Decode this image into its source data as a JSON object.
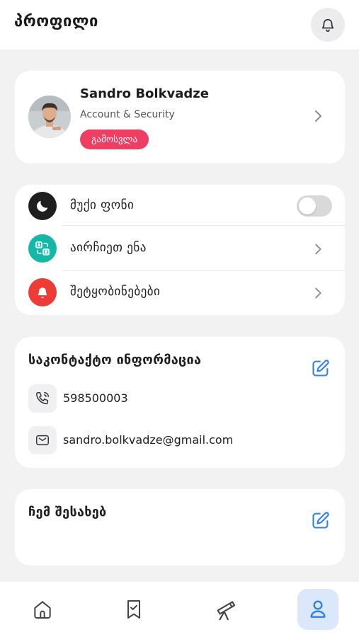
{
  "header": {
    "title": "პროფილი",
    "notification_icon": "bell-icon"
  },
  "profile": {
    "name": "Sandro Bolkvadze",
    "subtitle": "Account & Security",
    "logout_label": "გამოსვლა",
    "avatar_icon": "user-photo"
  },
  "settings": {
    "items": [
      {
        "label": "მუქი ფონი",
        "icon": "moon-icon",
        "icon_bg": "#1f1f1f",
        "control": "toggle",
        "toggle_on": false
      },
      {
        "label": "აირჩიეთ ენა",
        "icon": "translate-icon",
        "icon_bg": "#14b8a6",
        "control": "chevron"
      },
      {
        "label": "შეტყობინებები",
        "icon": "bell-icon",
        "icon_bg": "#ef3b36",
        "control": "chevron"
      }
    ]
  },
  "contact": {
    "title": "საკონტაქტო ინფორმაცია",
    "phone": "598500003",
    "email": "sandro.bolkvadze@gmail.com"
  },
  "about": {
    "title": "ჩემ შესახებ"
  },
  "bottom_nav": {
    "items": [
      {
        "icon": "home-icon",
        "active": false
      },
      {
        "icon": "bookmark-check-icon",
        "active": false
      },
      {
        "icon": "telescope-icon",
        "active": false
      },
      {
        "icon": "user-icon",
        "active": true
      }
    ]
  },
  "colors": {
    "accent": "#2f80ed",
    "logout": "#f03e62",
    "background": "#f2f2f3",
    "active_nav_bg": "#dbe8fb"
  }
}
